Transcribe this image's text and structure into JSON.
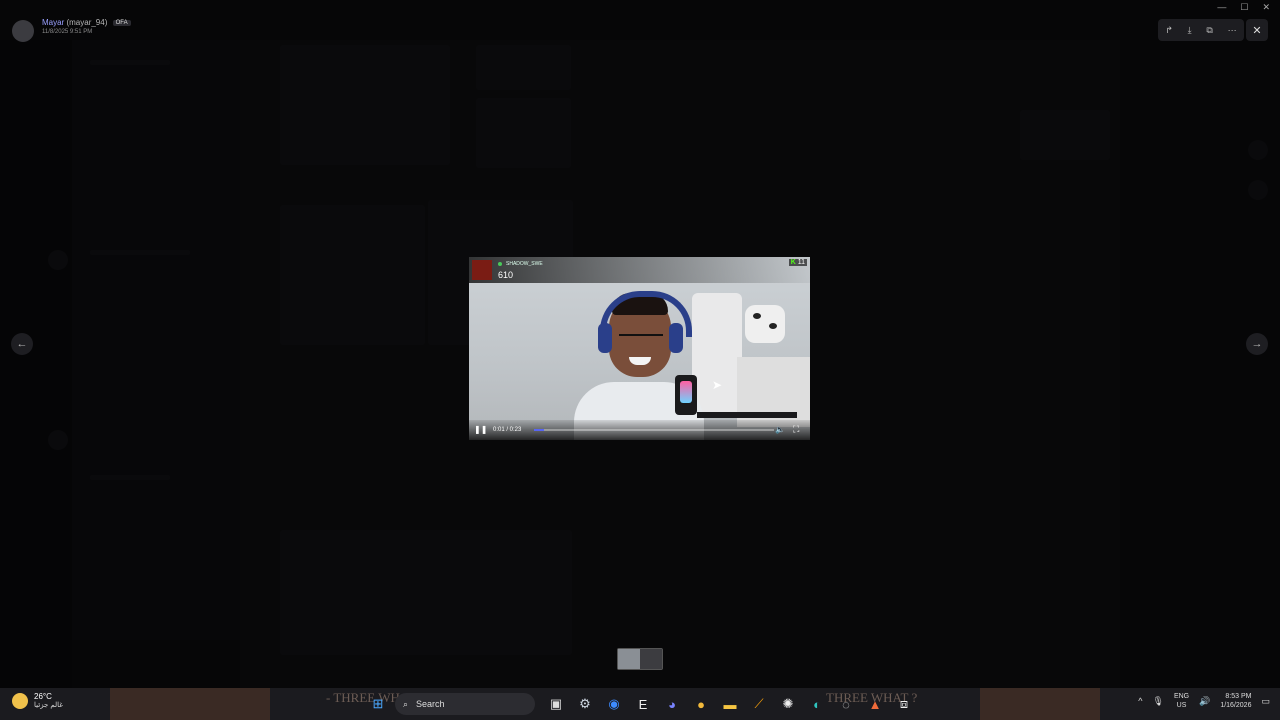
{
  "viewer": {
    "author_display": "Mayar",
    "author_username": "(mayar_94)",
    "author_tag": "OFA",
    "posted_at": "11/8/2025 9:51 PM",
    "actions": [
      "↱",
      "⤓",
      "⧉",
      "⋯"
    ],
    "close": "✕",
    "prev": "←",
    "next": "→"
  },
  "window_controls": [
    "—",
    "☐",
    "✕"
  ],
  "video": {
    "cam_name": "SHADOW_SWE",
    "cam_score": "610",
    "kick_logo": "K",
    "kick_count": "11",
    "pause": "❚❚",
    "time": "0:01 / 0:23",
    "progress": 0.04,
    "volume": "🔈",
    "fullscreen": "⛶"
  },
  "taskbar": {
    "temperature": "26°C",
    "weather_desc": "غالم جزئيا",
    "search_placeholder": "Search",
    "watermark_left": "- THREE WHAT ?",
    "watermark_right": "THREE WHAT ?",
    "lang_top": "ENG",
    "lang_bottom": "US",
    "time": "8:53 PM",
    "date": "1/16/2026",
    "apps": [
      {
        "name": "windows-start-icon",
        "glyph": "⊞",
        "color": "#4aa8ff"
      },
      {
        "name": "task-view-icon",
        "glyph": "▣",
        "color": "#ddd"
      },
      {
        "name": "steam-icon",
        "glyph": "⚙",
        "color": "#cfd8e3"
      },
      {
        "name": "app-blue-icon",
        "glyph": "◉",
        "color": "#3d8bff"
      },
      {
        "name": "epic-games-icon",
        "glyph": "E",
        "color": "#eee"
      },
      {
        "name": "discord-icon",
        "glyph": "◕",
        "color": "#7984ff"
      },
      {
        "name": "app-yellow-icon",
        "glyph": "●",
        "color": "#f2b93b"
      },
      {
        "name": "file-explorer-icon",
        "glyph": "▬",
        "color": "#f5c542"
      },
      {
        "name": "app-orange-icon",
        "glyph": "⟋",
        "color": "#f59e0b"
      },
      {
        "name": "steelseries-icon",
        "glyph": "✺",
        "color": "#eee"
      },
      {
        "name": "edge-icon",
        "glyph": "◐",
        "color": "#2fc6c0"
      },
      {
        "name": "app-globe-icon",
        "glyph": "◌",
        "color": "#ddd"
      },
      {
        "name": "app-triangle-icon",
        "glyph": "▲",
        "color": "#ef6b3a"
      },
      {
        "name": "capcut-icon",
        "glyph": "⧈",
        "color": "#eee"
      }
    ],
    "tray": [
      "^",
      "🎙",
      "🔊"
    ]
  },
  "colors": {
    "accent": "#5865f2",
    "kick_green": "#53fc18"
  }
}
